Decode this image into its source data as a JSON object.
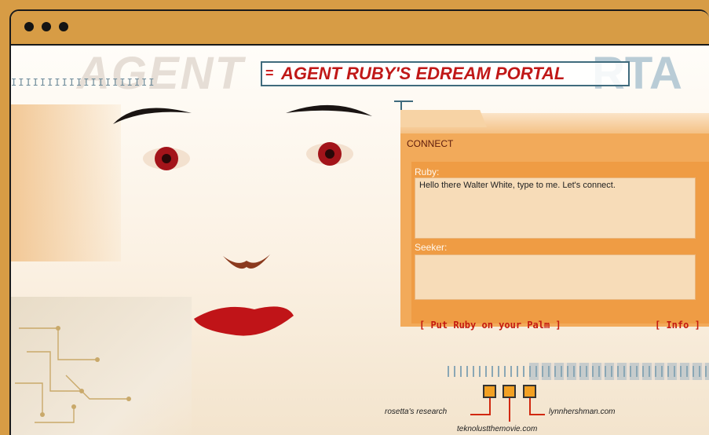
{
  "window": {
    "controls": [
      "close",
      "minimize",
      "maximize"
    ],
    "chrome_color": "#d79c45"
  },
  "banner": {
    "background_word_left": "AGENT",
    "background_word_right": "RTA",
    "title": "AGENT RUBY'S EDREAM PORTAL",
    "title_mark": "="
  },
  "chat": {
    "section_label": "CONNECT",
    "ruby_label": "Ruby:",
    "ruby_message": "Hello there Walter White, type to me. Let's connect.",
    "seeker_label": "Seeker:",
    "seeker_value": ""
  },
  "links": {
    "palm": "[ Put Ruby on your Palm ]",
    "info": "[ Info ]"
  },
  "footer": {
    "rosetta": "rosetta's research",
    "teknolust": "teknolustthemovie.com",
    "lynn": "lynnhershman.com"
  },
  "ticks": "IIIIIIIIIIIIIIIIIIII",
  "ticks_bottom": "IIIIIIIII"
}
